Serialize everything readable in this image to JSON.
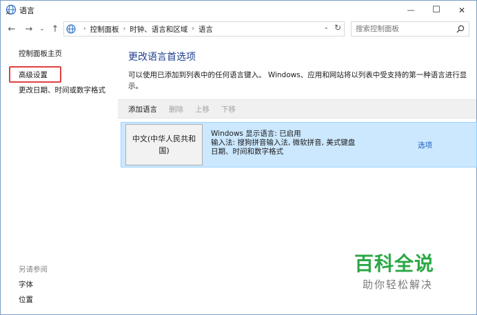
{
  "window": {
    "title": "语言",
    "minimize_glyph": "—",
    "maximize_glyph": "☐",
    "close_glyph": "✕"
  },
  "nav": {
    "back_glyph": "←",
    "forward_glyph": "→",
    "recent_glyph": "⌄",
    "up_glyph": "↑",
    "breadcrumbs": [
      "控制面板",
      "时钟、语言和区域",
      "语言"
    ],
    "crumb_separator": "›",
    "dropdown_glyph": "⌄",
    "refresh_glyph": "↻",
    "search_placeholder": "搜索控制面板"
  },
  "sidebar": {
    "home_link": "控制面板主页",
    "advanced_settings": "高级设置",
    "change_date": "更改日期、时间或数字格式",
    "see_also_label": "另请参阅",
    "fonts_link": "字体",
    "location_link": "位置"
  },
  "main": {
    "heading": "更改语言首选项",
    "description": "可以使用已添加到列表中的任何语言键入。 Windows、应用和网站将以列表中受支持的第一种语言进行显示。",
    "toolbar": {
      "add": "添加语言",
      "remove": "删除",
      "move_up": "上移",
      "move_down": "下移"
    },
    "languages": [
      {
        "name": "中文(中华人民共和国)",
        "display_status": "Windows 显示语言: 已启用",
        "input_methods": "输入法: 搜狗拼音输入法, 微软拼音, 美式键盘",
        "formats": "日期、时间和数字格式",
        "options": "选项"
      }
    ]
  },
  "watermark": {
    "brand": "百科全说",
    "slogan": "助你轻松解决"
  },
  "colors": {
    "heading": "#1e3f8f",
    "link": "#1e5fc2",
    "selection": "#cce8ff",
    "highlight_box": "#e04040",
    "watermark": "#2aa845"
  }
}
